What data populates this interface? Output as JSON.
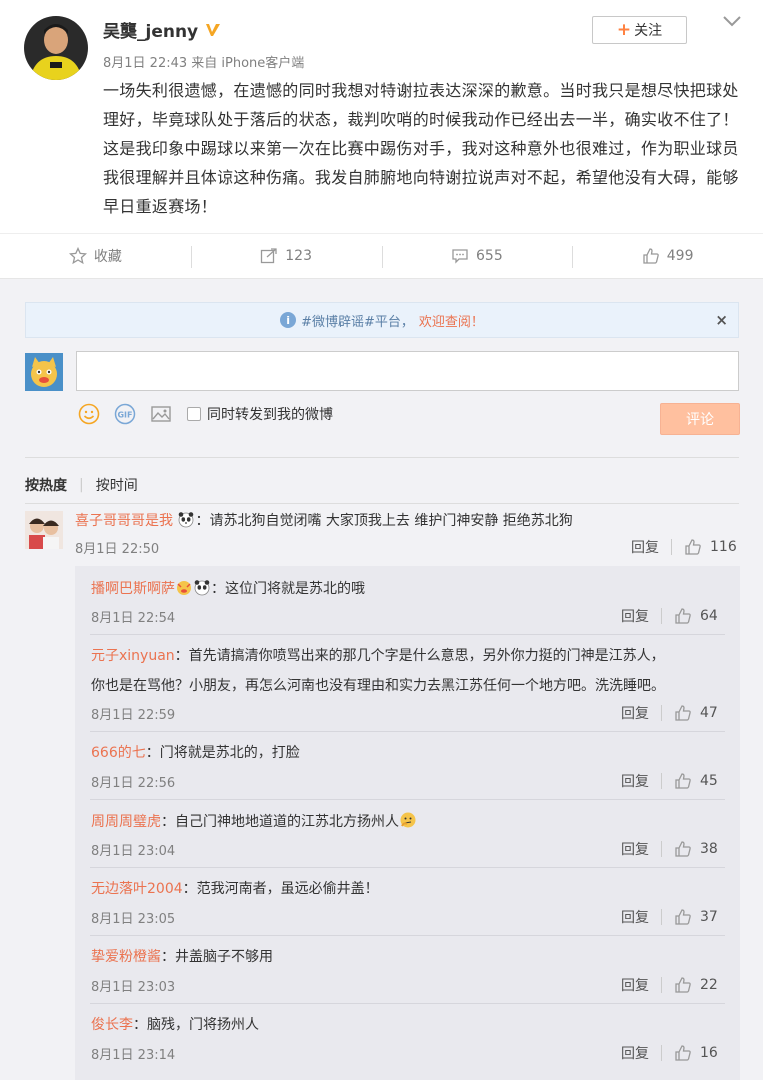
{
  "post": {
    "username": "吴龑_jenny",
    "meta": "8月1日 22:43 来自 iPhone客户端",
    "follow_label": "关注",
    "text": "一场失利很遗憾，在遗憾的同时我想对特谢拉表达深深的歉意。当时我只是想尽快把球处理好，毕竟球队处于落后的状态，裁判吹哨的时候我动作已经出去一半，确实收不住了！这是我印象中踢球以来第一次在比赛中踢伤对手，我对这种意外也很难过，作为职业球员我很理解并且体谅这种伤痛。我发自肺腑地向特谢拉说声对不起，希望他没有大碍，能够早日重返赛场！"
  },
  "actions": {
    "favorite": "收藏",
    "repost": "123",
    "comment": "655",
    "like": "499"
  },
  "notice": {
    "tag": "#微博辟谣#平台，",
    "cta": "欢迎查阅！",
    "close": "×"
  },
  "compose": {
    "input_value": "",
    "repost_label": "同时转发到我的微博",
    "submit_label": "评论"
  },
  "sort": {
    "by_hot": "按热度",
    "by_time": "按时间"
  },
  "reply_label": "回复",
  "top_comment": {
    "user": "喜子哥哥哥是我",
    "text": "：请苏北狗自觉闭嘴 大家顶我上去 维护门神安静 拒绝苏北狗",
    "time": "8月1日 22:50",
    "likes": "116"
  },
  "replies": [
    {
      "user": "播啊巴斯啊萨",
      "text": "：这位门将就是苏北的哦",
      "time": "8月1日 22:54",
      "likes": "64"
    },
    {
      "user": "元子xinyuan",
      "text": "：首先请搞清你喷骂出来的那几个字是什么意思，另外你力挺的门神是江苏人，",
      "text2": "你也是在骂他？小朋友，再怎么河南也没有理由和实力去黑江苏任何一个地方吧。洗洗睡吧。",
      "time": "8月1日 22:59",
      "likes": "47"
    },
    {
      "user": "666的七",
      "text": "：门将就是苏北的，打脸",
      "time": "8月1日 22:56",
      "likes": "45"
    },
    {
      "user": "周周周璧虎",
      "text": "：自己门神地地道道的江苏北方扬州人",
      "time": "8月1日 23:04",
      "likes": "38"
    },
    {
      "user": "无边落叶2004",
      "text": "：范我河南者，虽远必偷井盖！",
      "time": "8月1日 23:05",
      "likes": "37"
    },
    {
      "user": "挚爱粉橙酱",
      "text": "：井盖脑子不够用",
      "time": "8月1日 23:03",
      "likes": "22"
    },
    {
      "user": "俊长李",
      "text": "：脑残，门将扬州人",
      "time": "8月1日 23:14",
      "likes": "16"
    }
  ],
  "colors": {
    "accent": "#eb7350",
    "meta": "#808080",
    "panel": "#f2f2f5",
    "subpanel": "#e9e9ee"
  }
}
